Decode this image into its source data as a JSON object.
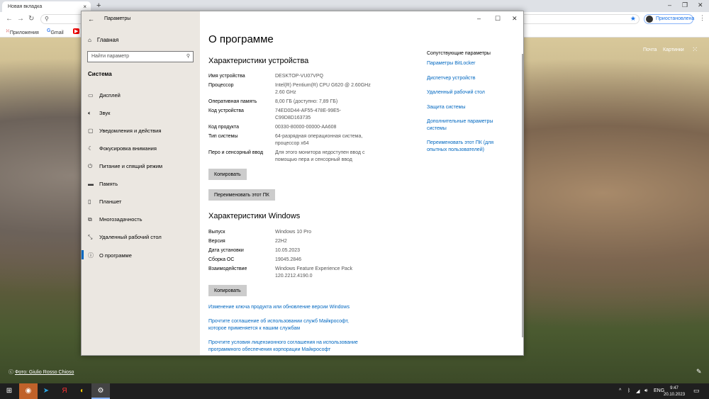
{
  "browser": {
    "tab_title": "Новая вкладка",
    "profile_label": "Приостановлена",
    "bookmarks": [
      "Приложения",
      "Gmail"
    ],
    "google_links": [
      "Почта",
      "Картинки"
    ],
    "photo_credit": "Фото: Giulio Rosso Chioso"
  },
  "settings": {
    "window_title": "Параметры",
    "home": "Главная",
    "search_placeholder": "Найти параметр",
    "section": "Система",
    "nav": [
      {
        "icon": "display",
        "label": "Дисплей"
      },
      {
        "icon": "sound",
        "label": "Звук"
      },
      {
        "icon": "notifications",
        "label": "Уведомления и действия"
      },
      {
        "icon": "focus",
        "label": "Фокусировка внимания"
      },
      {
        "icon": "power",
        "label": "Питание и спящий режим"
      },
      {
        "icon": "storage",
        "label": "Память"
      },
      {
        "icon": "tablet",
        "label": "Планшет"
      },
      {
        "icon": "multitasking",
        "label": "Многозадачность"
      },
      {
        "icon": "remote",
        "label": "Удаленный рабочий стол"
      },
      {
        "icon": "info",
        "label": "О программе"
      }
    ],
    "page_title": "О программе",
    "device_heading": "Характеристики устройства",
    "device_specs": [
      {
        "k": "Имя устройства",
        "v": "DESKTOP-VU07VPQ"
      },
      {
        "k": "Процессор",
        "v": "Intel(R) Pentium(R) CPU G620 @ 2.60GHz 2.60 GHz"
      },
      {
        "k": "Оперативная память",
        "v": "8,00 ГБ (доступно: 7,89 ГБ)"
      },
      {
        "k": "Код устройства",
        "v": "74ED0D44-AF55-478E-99E5-C99D8D163735"
      },
      {
        "k": "Код продукта",
        "v": "00330-80000-00000-AA608"
      },
      {
        "k": "Тип системы",
        "v": "64-разрядная операционная система, процессор x64"
      },
      {
        "k": "Перо и сенсорный ввод",
        "v": "Для этого монитора недоступен ввод с помощью пера и сенсорный ввод"
      }
    ],
    "copy_label": "Копировать",
    "rename_label": "Переименовать этот ПК",
    "windows_heading": "Характеристики Windows",
    "windows_specs": [
      {
        "k": "Выпуск",
        "v": "Windows 10 Pro"
      },
      {
        "k": "Версия",
        "v": "22H2"
      },
      {
        "k": "Дата установки",
        "v": "10.05.2023"
      },
      {
        "k": "Сборка ОС",
        "v": "19045.2846"
      },
      {
        "k": "Взаимодействие",
        "v": "Windows Feature Experience Pack 120.2212.4190.0"
      }
    ],
    "links": [
      "Изменение ключа продукта или обновление версии Windows",
      "Прочтите соглашение об использовании служб Майкрософт, которое применяется к нашим службам",
      "Прочтите условия лицензионного соглашения на использование программного обеспечения корпорации Майкрософт"
    ],
    "related_heading": "Сопутствующие параметры",
    "related": [
      "Параметры BitLocker",
      "Диспетчер устройств",
      "Удаленный рабочий стол",
      "Защита системы",
      "Дополнительные параметры системы",
      "Переименовать этот ПК (для опытных пользователей)"
    ]
  },
  "taskbar": {
    "lang": "ENG",
    "time": "9:47",
    "date": "20.10.2023"
  }
}
